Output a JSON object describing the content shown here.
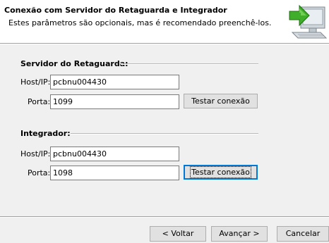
{
  "header": {
    "title": "Conexão com Servidor do Retaguarda e Integrador",
    "subtitle": "Estes parâmetros são opcionais, mas é recomendado preenchê-los.",
    "icon": "computer-network-arrow-icon"
  },
  "retaguarda": {
    "title": "Servidor do Retaguarda:",
    "host_label": "Host/IP:",
    "host_value": "pcbnu004430",
    "port_label": "Porta:",
    "port_value": "1099",
    "test_button": "Testar conexão"
  },
  "integrador": {
    "title": "Integrador:",
    "host_label": "Host/IP:",
    "host_value": "pcbnu004430",
    "port_label": "Porta:",
    "port_value": "1098",
    "test_button": "Testar conexão"
  },
  "footer": {
    "back": "< Voltar",
    "next": "Avançar >",
    "cancel": "Cancelar"
  },
  "colors": {
    "focus_border": "#0078d7",
    "button_bg": "#e1e1e1",
    "window_bg": "#f0f0f0"
  }
}
